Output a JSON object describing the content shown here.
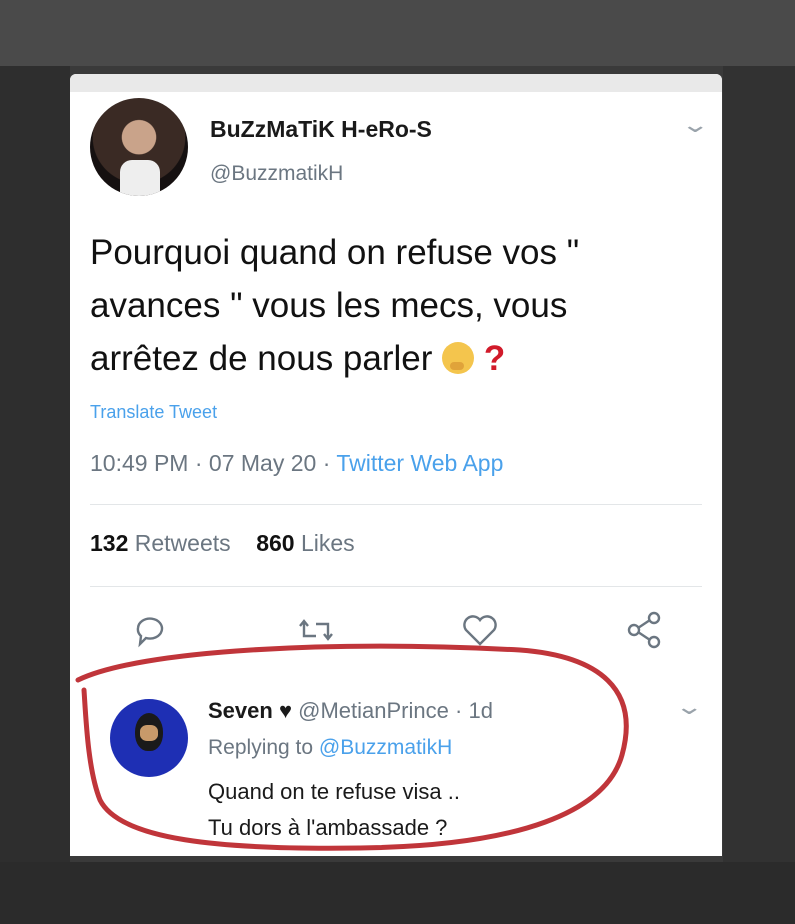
{
  "tweet": {
    "display_name": "BuZzMaTiK H-eRo-S",
    "handle": "@BuzzmatikH",
    "text_line1": "Pourquoi quand on refuse vos \"",
    "text_line2": "avances \" vous les mecs, vous",
    "text_line3": "arrêtez de nous parler",
    "emoji": "thinking-face-emoji",
    "question_mark": "?",
    "translate_label": "Translate Tweet",
    "time": "10:49 PM",
    "date": "07 May 20",
    "source": "Twitter Web App",
    "retweets_count": "132",
    "retweets_label": "Retweets",
    "likes_count": "860",
    "likes_label": "Likes"
  },
  "actions": [
    "reply-icon",
    "retweet-icon",
    "like-icon",
    "share-icon"
  ],
  "reply": {
    "display_name": "Seven",
    "heart": "♥",
    "handle": "@MetianPrince",
    "age": "1d",
    "replying_prefix": "Replying to",
    "replying_mention": "@BuzzmatikH",
    "text_line1": "Quand on te refuse visa ..",
    "text_line2": "Tu dors à l'ambassade ?"
  },
  "colors": {
    "link": "#4aa1eb",
    "secondary_text": "#6b7681",
    "highlight_ring": "#c0353a"
  }
}
